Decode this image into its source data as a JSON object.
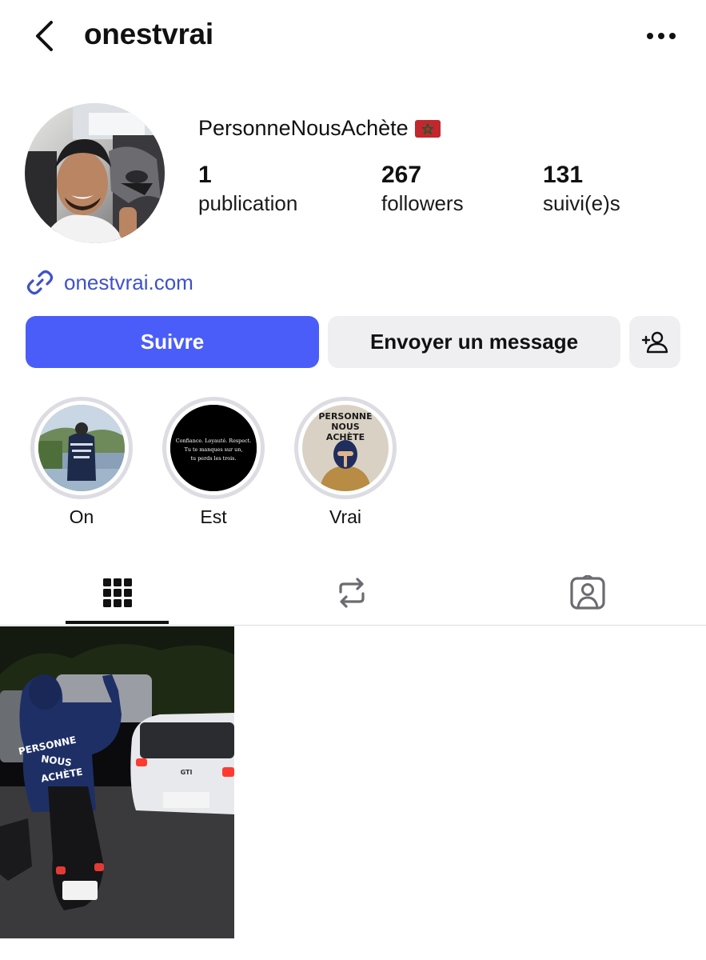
{
  "header": {
    "username": "onestvrai",
    "back_icon": "chevron-left-icon",
    "more_icon": "more-horizontal-icon"
  },
  "profile": {
    "display_name": "PersonneNousAchète",
    "flag": "morocco-flag-icon",
    "stats": {
      "posts": {
        "count": "1",
        "label": "publication"
      },
      "followers": {
        "count": "267",
        "label": "followers"
      },
      "following": {
        "count": "131",
        "label": "suivi(e)s"
      }
    },
    "link": {
      "text": "onestvrai.com",
      "icon": "link-icon"
    }
  },
  "actions": {
    "follow_label": "Suivre",
    "message_label": "Envoyer un message",
    "add_user_icon": "add-person-icon"
  },
  "highlights": [
    {
      "label": "On"
    },
    {
      "label": "Est",
      "cover_lines": [
        "Confiance. Loyauté. Respect.",
        "Tu te manques sur un,",
        "tu perds les trois."
      ]
    },
    {
      "label": "Vrai",
      "cover_title": [
        "PERSONNE",
        "NOUS",
        "ACHÈTE"
      ]
    }
  ],
  "tabs": [
    {
      "name": "posts-grid",
      "icon": "grid-icon",
      "active": true
    },
    {
      "name": "reposts",
      "icon": "repost-icon",
      "active": false
    },
    {
      "name": "tagged",
      "icon": "tagged-person-icon",
      "active": false
    }
  ],
  "posts": [
    {
      "hoodie_text": [
        "PERSONNE",
        "NOUS",
        "ACHÈTE"
      ],
      "car_badge": "GTI"
    }
  ],
  "colors": {
    "accent": "#4a5df9",
    "link": "#3f51c9",
    "secondary_button": "#efeff2",
    "ring": "#dcdce2"
  }
}
